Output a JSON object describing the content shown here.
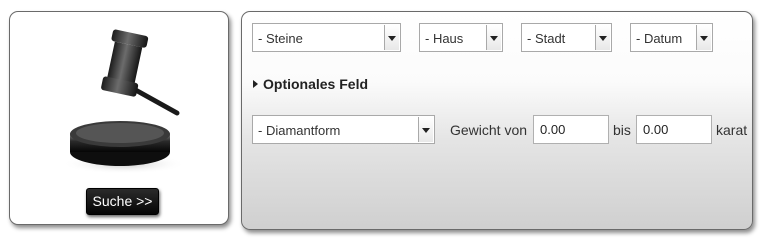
{
  "search_button": {
    "label": "Suche >>"
  },
  "filters": {
    "stones": "- Steine",
    "house": "- Haus",
    "city": "- Stadt",
    "date": "- Datum"
  },
  "optional_toggle": {
    "label": "Optionales Feld"
  },
  "diamond_shape": {
    "value": "- Diamantform"
  },
  "weight": {
    "label_from": "Gewicht von",
    "from_value": "0.00",
    "label_to": "bis",
    "to_value": "0.00",
    "unit": "karat"
  },
  "icons": {
    "gavel": "gavel-icon"
  }
}
